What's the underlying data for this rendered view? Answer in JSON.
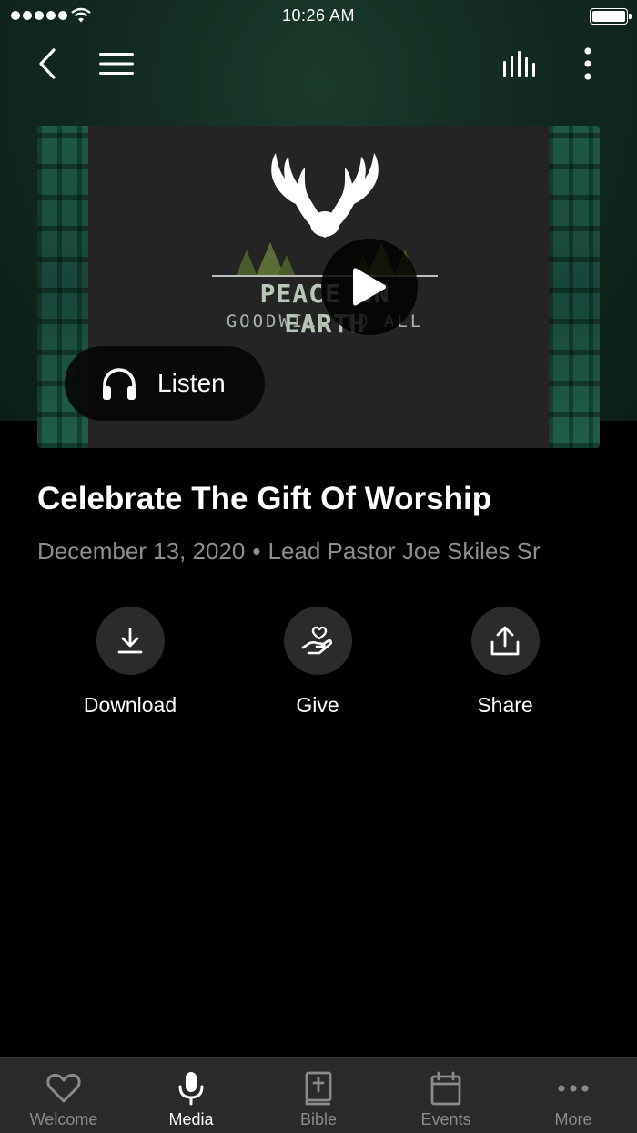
{
  "status_bar": {
    "time": "10:26 AM"
  },
  "media": {
    "artwork_title": "PEACE ON EARTH",
    "artwork_subtitle": "GOODWILL TO ALL",
    "listen_label": "Listen"
  },
  "sermon": {
    "title": "Celebrate The Gift Of Worship",
    "date": "December 13, 2020",
    "separator": "•",
    "speaker": "Lead Pastor Joe Skiles Sr"
  },
  "actions": {
    "download_label": "Download",
    "give_label": "Give",
    "share_label": "Share"
  },
  "tab_bar": {
    "tabs": [
      {
        "label": "Welcome",
        "icon": "heart-icon",
        "active": false
      },
      {
        "label": "Media",
        "icon": "microphone-icon",
        "active": true
      },
      {
        "label": "Bible",
        "icon": "bible-icon",
        "active": false
      },
      {
        "label": "Events",
        "icon": "calendar-icon",
        "active": false
      },
      {
        "label": "More",
        "icon": "more-dots-icon",
        "active": false
      }
    ]
  },
  "colors": {
    "header_bg": "#132a20",
    "accent_active": "#ffffff",
    "tab_inactive": "#8a8a8a",
    "tab_bar_bg": "#2a2a2a",
    "action_circle_bg": "#2b2b2b"
  }
}
